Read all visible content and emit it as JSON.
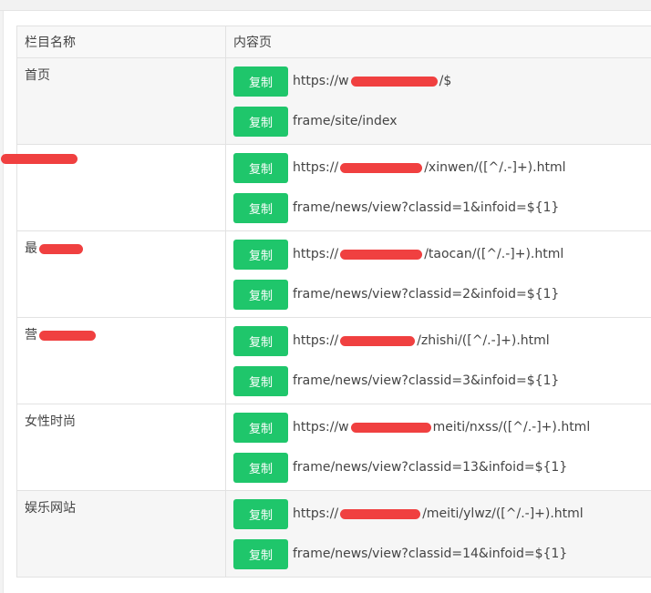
{
  "table": {
    "headers": {
      "name": "栏目名称",
      "content": "内容页"
    },
    "copy_label": "复制",
    "rows": [
      {
        "name": "首页",
        "url_prefix": "https://w",
        "url_suffix": "/$",
        "route": "frame/site/index"
      },
      {
        "name": "",
        "url_prefix": "https://",
        "url_suffix": "/xinwen/([^/.-]+).html",
        "route": "frame/news/view?classid=1&infoid=${1}"
      },
      {
        "name": "最",
        "url_prefix": "https://",
        "url_suffix": "/taocan/([^/.-]+).html",
        "route": "frame/news/view?classid=2&infoid=${1}"
      },
      {
        "name": "营",
        "url_prefix": "https://",
        "url_suffix": "/zhishi/([^/.-]+).html",
        "route": "frame/news/view?classid=3&infoid=${1}"
      },
      {
        "name": "女性时尚",
        "url_prefix": "https://w",
        "url_suffix": "meiti/nxss/([^/.-]+).html",
        "route": "frame/news/view?classid=13&infoid=${1}"
      },
      {
        "name": "娱乐网站",
        "url_prefix": "https://",
        "url_suffix": "/meiti/ylwz/([^/.-]+).html",
        "route": "frame/news/view?classid=14&infoid=${1}"
      }
    ]
  },
  "colors": {
    "copy_button": "#1fc66b",
    "redaction": "#f04040"
  }
}
